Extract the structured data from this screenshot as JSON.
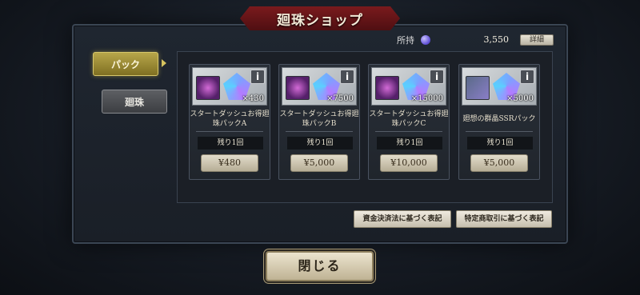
{
  "title": "廻珠ショップ",
  "balance": {
    "label": "所持",
    "icon": "gem-icon",
    "value": "3,550",
    "detail_label": "詳細"
  },
  "tabs": [
    {
      "label": "パック",
      "selected": true
    },
    {
      "label": "廻珠",
      "selected": false
    }
  ],
  "cards": [
    {
      "name": "スタートダッシュお得廻珠パックA",
      "count": "×430",
      "remaining": "残り1回",
      "price": "¥480",
      "info": "i"
    },
    {
      "name": "スタートダッシュお得廻珠パックB",
      "count": "×7500",
      "remaining": "残り1回",
      "price": "¥5,000",
      "info": "i"
    },
    {
      "name": "スタートダッシュお得廻珠パックC",
      "count": "×15000",
      "remaining": "残り1回",
      "price": "¥10,000",
      "info": "i"
    },
    {
      "name": "廻想の群晶SSRパック",
      "count": "×5000",
      "remaining": "残り1回",
      "price": "¥5,000",
      "info": "i"
    }
  ],
  "legal": {
    "payment_label": "資金決済法に基づく表記",
    "commerce_label": "特定商取引に基づく表記"
  },
  "close_label": "閉じる"
}
